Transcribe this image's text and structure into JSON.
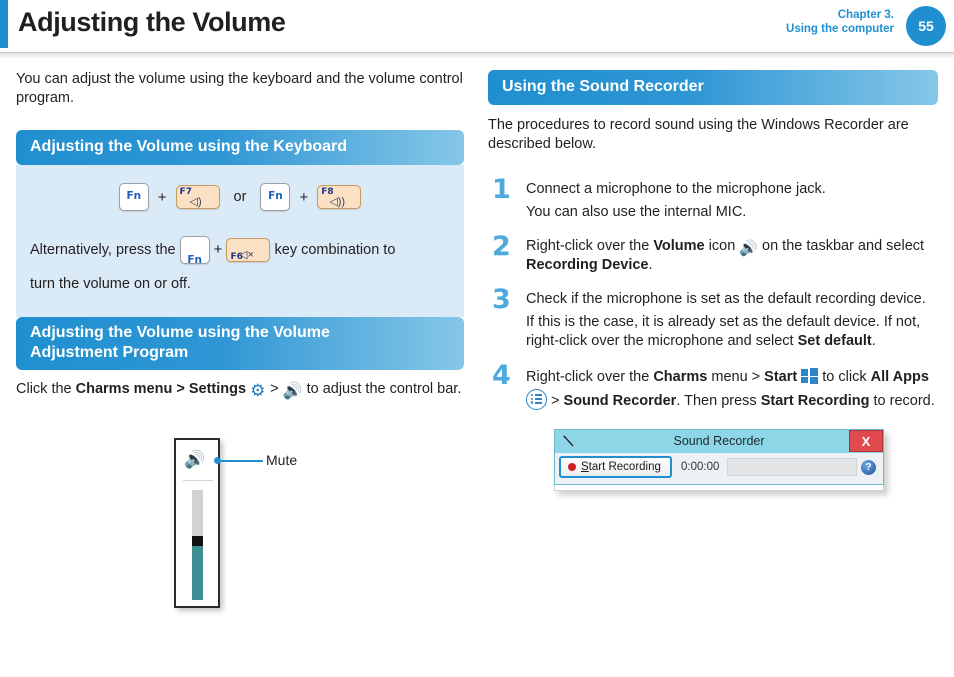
{
  "header": {
    "title": "Adjusting the Volume",
    "chapter_line1": "Chapter 3.",
    "chapter_line2": "Using the computer",
    "page_number": "55",
    "accent_color": "#1f8fd0"
  },
  "left": {
    "intro": "You can adjust the volume using the keyboard and the volume control program.",
    "section1_heading": "Adjusting the Volume using the Keyboard",
    "keybox": {
      "fn_label": "Fn",
      "plus": "+",
      "or": "or",
      "key_f7_label": "F7",
      "key_f7_glyph": "◁)",
      "key_f8_label": "F8",
      "key_f8_glyph": "◁))",
      "key_f6_label": "F6",
      "key_f6_glyph": "◁×",
      "alt_text_before": "Alternatively, press the",
      "alt_text_middle": "key combination to",
      "alt_text_after": "turn the volume on or off."
    },
    "section2_heading_line1": "Adjusting the Volume using the Volume",
    "section2_heading_line2": "Adjustment Program",
    "click_text_before": "Click the",
    "click_bold": "Charms menu > Settings",
    "click_gt": ">",
    "click_text_after": "to adjust the control bar.",
    "figure": {
      "callout_label": "Mute"
    }
  },
  "right": {
    "section_heading": "Using the Sound Recorder",
    "intro": "The procedures to record sound using the Windows Recorder are described below.",
    "steps": [
      {
        "num": "1",
        "line1": "Connect a microphone to the microphone jack.",
        "line2": "You can also use the internal MIC."
      },
      {
        "num": "2",
        "text_a": "Right-click over the",
        "bold_a": "Volume",
        "text_b": "icon",
        "text_c": "on the taskbar and select",
        "bold_b": "Recording Device",
        "text_d": "."
      },
      {
        "num": "3",
        "line1": "Check if the microphone is set as the default recording device.",
        "line2a": "If this is the case, it is already set as the default device. If not, right-click over the microphone and select",
        "line2b": "Set default",
        "line2c": "."
      },
      {
        "num": "4",
        "text_a": "Right-click over the",
        "bold_a": "Charms",
        "text_b": "menu >",
        "bold_b": "Start",
        "text_c": "to click",
        "bold_c": "All Apps",
        "text_d": ">",
        "bold_d": "Sound Recorder",
        "text_e": ". Then press",
        "bold_e": "Start Recording",
        "text_f": "to record."
      }
    ],
    "recorder": {
      "window_title": "Sound Recorder",
      "close_label": "X",
      "start_button_label_u": "S",
      "start_button_label": "tart Recording",
      "timer": "0:00:00",
      "help_label": "?"
    }
  }
}
